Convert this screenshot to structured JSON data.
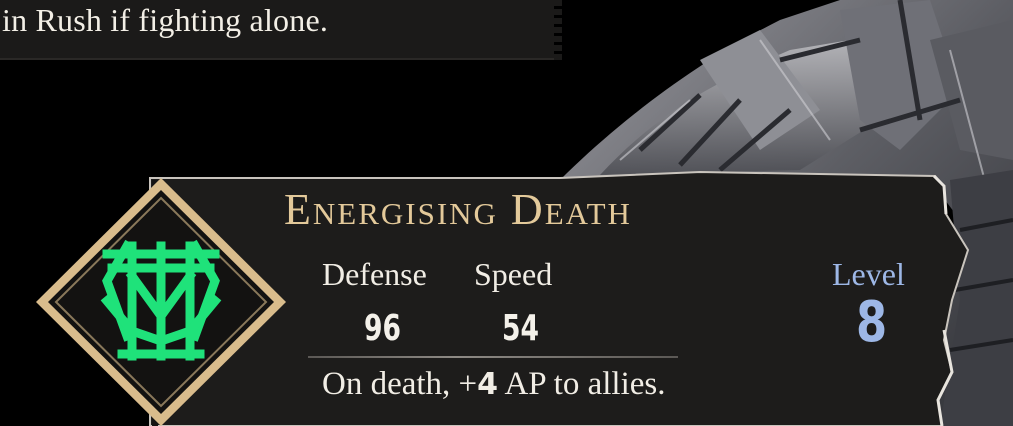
{
  "top_tooltip": {
    "text": "in Rush if fighting alone."
  },
  "ability_card": {
    "title": "Energising Death",
    "stats": [
      {
        "label": "Defense",
        "value": "96"
      },
      {
        "label": "Speed",
        "value": "54"
      }
    ],
    "effect": {
      "prefix": "On death, +",
      "amount": "4",
      "suffix": " AP to allies."
    },
    "level": {
      "label": "Level",
      "value": "8"
    },
    "emblem_icon": "green-rune-icon"
  },
  "colors": {
    "title": "#e3c99a",
    "level": "#9db7e6",
    "emblem": "#1fe27a",
    "frame": "#d9bc8c",
    "panel": "#1b1a19"
  }
}
